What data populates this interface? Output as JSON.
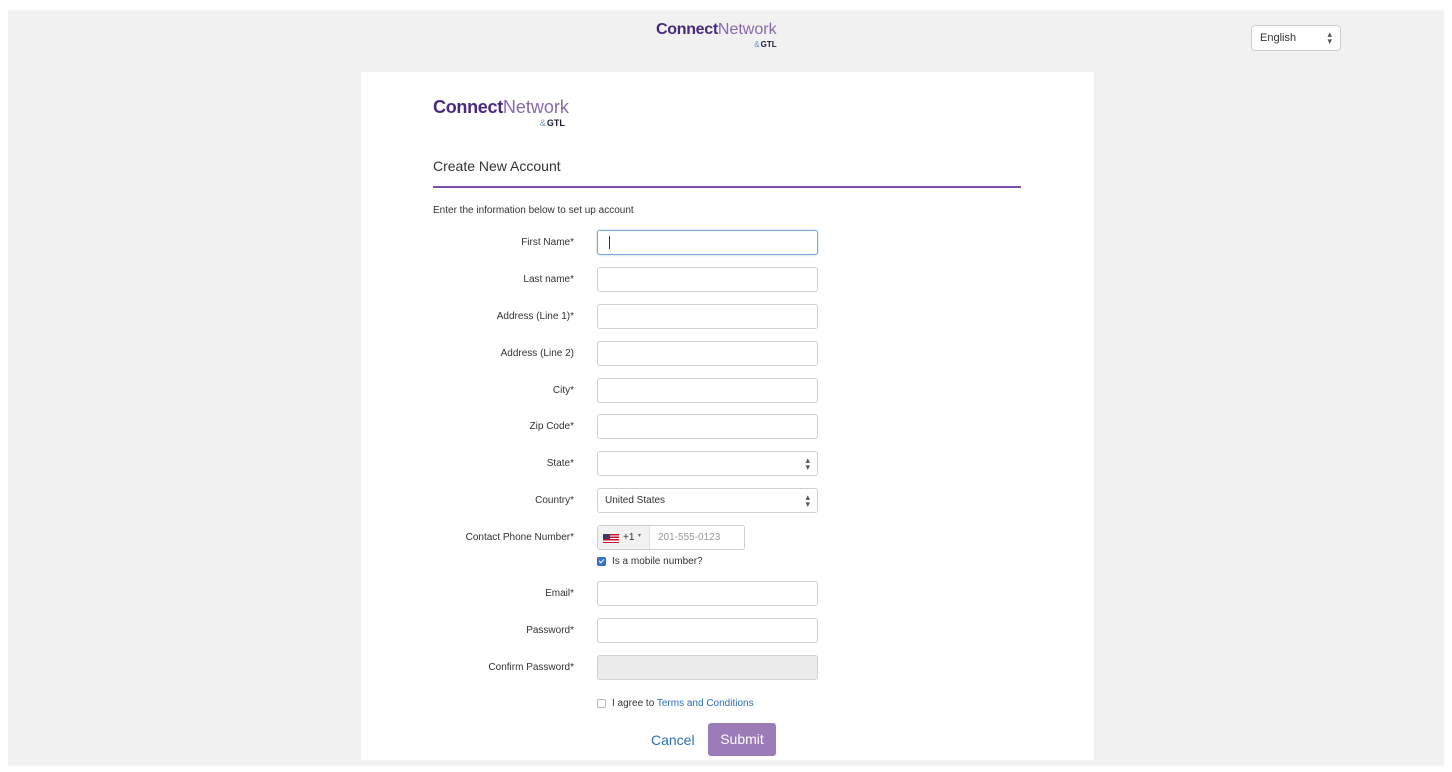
{
  "header": {
    "logo": {
      "connect": "Connect",
      "network": "Network",
      "amp": "&",
      "gtl": "GTL"
    },
    "language_select": {
      "value": "English"
    }
  },
  "card": {
    "logo": {
      "connect": "Connect",
      "network": "Network",
      "amp": "&",
      "gtl": "GTL"
    },
    "title": "Create New Account",
    "intro": "Enter the information below to set up account",
    "fields": {
      "first_name": {
        "label": "First Name*",
        "value": ""
      },
      "last_name": {
        "label": "Last name*",
        "value": ""
      },
      "address1": {
        "label": "Address (Line 1)*",
        "value": ""
      },
      "address2": {
        "label": "Address (Line 2)",
        "value": ""
      },
      "city": {
        "label": "City*",
        "value": ""
      },
      "zip": {
        "label": "Zip Code*",
        "value": ""
      },
      "state": {
        "label": "State*",
        "value": ""
      },
      "country": {
        "label": "Country*",
        "value": "United States"
      },
      "phone": {
        "label": "Contact Phone Number*",
        "dial_code": "+1",
        "placeholder": "201-555-0123",
        "flag": "us-flag-icon"
      },
      "is_mobile": {
        "label": "Is a mobile number?",
        "checked": true
      },
      "email": {
        "label": "Email*",
        "value": ""
      },
      "password": {
        "label": "Password*",
        "value": ""
      },
      "confirm_password": {
        "label": "Confirm Password*",
        "value": ""
      }
    },
    "terms": {
      "prefix": "I agree to",
      "link": "Terms and Conditions",
      "checked": false
    },
    "actions": {
      "cancel": "Cancel",
      "submit": "Submit"
    }
  },
  "colors": {
    "brand_purple": "#4a2a7c",
    "rule_purple": "#7b4ea8",
    "submit_button": "#9b7bb8",
    "link_blue": "#2a6fb8",
    "background": "#f1f1f1"
  }
}
